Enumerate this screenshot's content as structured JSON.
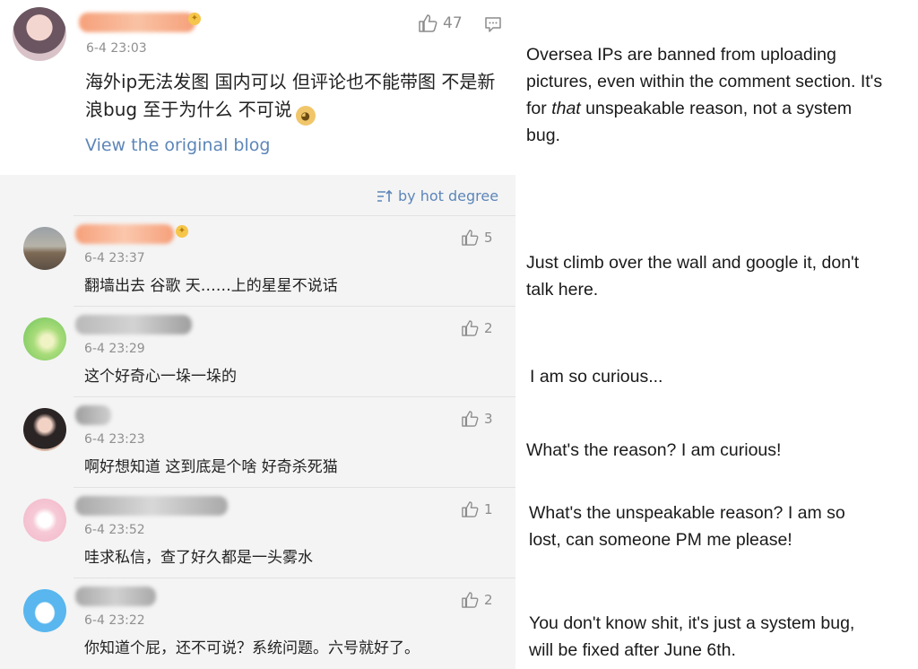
{
  "post": {
    "avatar_icon": "user-avatar",
    "timestamp": "6-4 23:03",
    "likes": "47",
    "like_icon": "thumbs-up-icon",
    "comment_icon": "comment-icon",
    "content": "海外ip无法发图 国内可以 但评论也不能带图 不是新浪bug 至于为什么 不可说",
    "emoji": "doge-emoji",
    "view_original": "View the original blog"
  },
  "comments_panel": {
    "sort_label": "by hot degree",
    "sort_icon": "sort-icon",
    "items": [
      {
        "timestamp": "6-4 23:37",
        "text": "翻墙出去 谷歌 天……上的星星不说话",
        "likes": "5"
      },
      {
        "timestamp": "6-4 23:29",
        "text": "这个好奇心一垛一垛的",
        "likes": "2"
      },
      {
        "timestamp": "6-4 23:23",
        "text": "啊好想知道 这到底是个啥 好奇杀死猫",
        "likes": "3"
      },
      {
        "timestamp": "6-4 23:52",
        "text": "哇求私信，查了好久都是一头雾水",
        "likes": "1"
      },
      {
        "timestamp": "6-4 23:22",
        "text": "你知道个屁，还不可说？系统问题。六号就好了。",
        "likes": "2"
      }
    ]
  },
  "translations": {
    "t0_a": "Oversea IPs are banned from uploading pictures, even within the comment section. It's for ",
    "t0_em": "that",
    "t0_b": " unspeakable reason, not a system bug.",
    "t1": "Just climb over the wall and google it, don't talk here.",
    "t2": "I am so curious...",
    "t3": "What's the reason? I am curious!",
    "t4": "What's the unspeakable reason? I am so lost, can someone PM me please!",
    "t5": "You don't know shit, it's just a system bug, will be fixed after June 6th."
  },
  "colors": {
    "link": "#5d86b8",
    "panel_bg": "#f4f4f4",
    "redaction": "#f6a07a"
  }
}
